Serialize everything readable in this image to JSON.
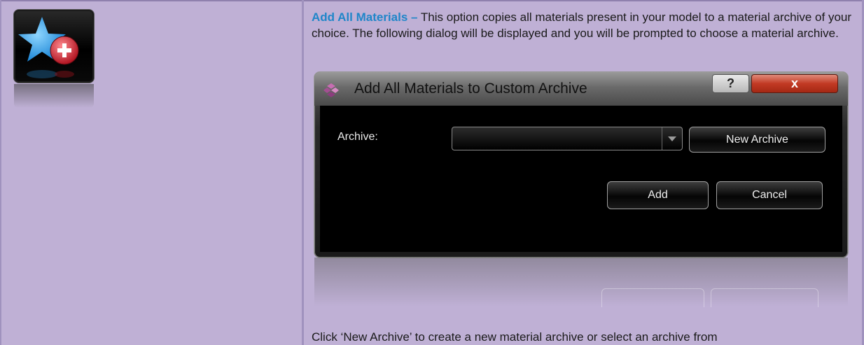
{
  "description": {
    "term": "Add All Materials",
    "dash": " –",
    "text": " This option copies all materials present in your model to a material archive of your choice. The following dialog will be displayed and you will be prompted to choose a material archive."
  },
  "dialog": {
    "title": "Add All Materials to Custom Archive",
    "help_label": "?",
    "close_label": "x",
    "archive_label": "Archive:",
    "archive_value": "",
    "new_archive_label": "New Archive",
    "add_label": "Add",
    "cancel_label": "Cancel"
  },
  "bottom_text": "Click ‘New Archive’ to create a new material archive or select an archive from",
  "icons": {
    "feature": "star-add-icon",
    "dialog": "materials-app-icon"
  },
  "colors": {
    "table_bg": "#bfb0d5",
    "term": "#1f86c9",
    "star": "#3aa7e8",
    "badge": "#d72b36"
  }
}
